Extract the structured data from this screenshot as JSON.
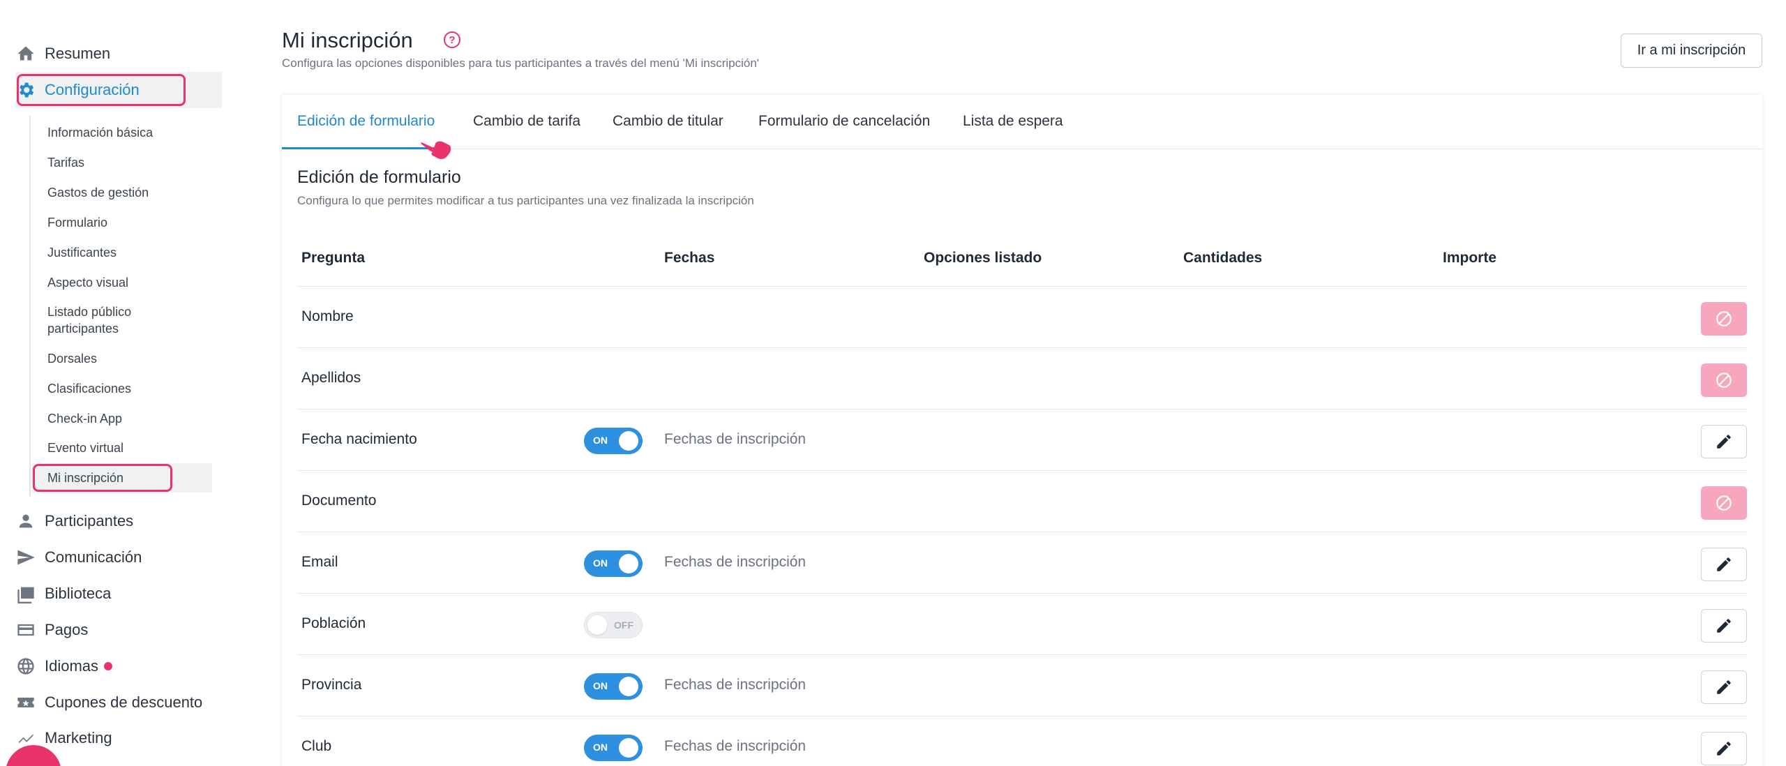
{
  "sidebar": {
    "items": [
      {
        "label": "Resumen",
        "icon": "home-icon"
      },
      {
        "label": "Configuración",
        "icon": "gear-icon",
        "active": true
      },
      {
        "label": "Participantes",
        "icon": "person-icon"
      },
      {
        "label": "Comunicación",
        "icon": "send-icon"
      },
      {
        "label": "Biblioteca",
        "icon": "photo-library-icon"
      },
      {
        "label": "Pagos",
        "icon": "credit-card-icon"
      },
      {
        "label": "Idiomas",
        "icon": "globe-icon",
        "has_dot": true
      },
      {
        "label": "Cupones de descuento",
        "icon": "ticket-icon"
      },
      {
        "label": "Marketing",
        "icon": "trend-icon"
      }
    ],
    "subitems": [
      {
        "label": "Información básica"
      },
      {
        "label": "Tarifas"
      },
      {
        "label": "Gastos de gestión"
      },
      {
        "label": "Formulario"
      },
      {
        "label": "Justificantes"
      },
      {
        "label": "Aspecto visual"
      },
      {
        "label": "Listado público participantes"
      },
      {
        "label": "Dorsales"
      },
      {
        "label": "Clasificaciones"
      },
      {
        "label": "Check-in App"
      },
      {
        "label": "Evento virtual"
      },
      {
        "label": "Mi inscripción",
        "active": true
      }
    ]
  },
  "header": {
    "title": "Mi inscripción",
    "help_icon": "question-circle-icon",
    "help_glyph": "?",
    "subtitle": "Configura las opciones disponibles para tus participantes a través del menú 'Mi inscripción'",
    "goto_button": "Ir a mi inscripción"
  },
  "tabs": [
    {
      "label": "Edición de formulario",
      "active": true
    },
    {
      "label": "Cambio de tarifa"
    },
    {
      "label": "Cambio de titular"
    },
    {
      "label": "Formulario de cancelación"
    },
    {
      "label": "Lista de espera"
    }
  ],
  "section": {
    "title": "Edición de formulario",
    "subtitle": "Configura lo que permites modificar a tus participantes una vez finalizada la inscripción"
  },
  "table": {
    "columns": [
      "Pregunta",
      "Fechas",
      "Opciones listado",
      "Cantidades",
      "Importe"
    ],
    "rows": [
      {
        "question": "Nombre",
        "toggle": null,
        "dates": "",
        "action": "disabled"
      },
      {
        "question": "Apellidos",
        "toggle": null,
        "dates": "",
        "action": "disabled"
      },
      {
        "question": "Fecha nacimiento",
        "toggle": "ON",
        "dates": "Fechas de inscripción",
        "action": "edit"
      },
      {
        "question": "Documento",
        "toggle": null,
        "dates": "",
        "action": "disabled"
      },
      {
        "question": "Email",
        "toggle": "ON",
        "dates": "Fechas de inscripción",
        "action": "edit"
      },
      {
        "question": "Población",
        "toggle": "OFF",
        "dates": "",
        "action": "edit"
      },
      {
        "question": "Provincia",
        "toggle": "ON",
        "dates": "Fechas de inscripción",
        "action": "edit"
      },
      {
        "question": "Club",
        "toggle": "ON",
        "dates": "Fechas de inscripción",
        "action": "edit"
      }
    ]
  },
  "colors": {
    "accent": "#2289d0",
    "highlight": "#e8336c",
    "toggle_on": "#2d8fe0",
    "disabled_button": "#f7a6bd"
  }
}
